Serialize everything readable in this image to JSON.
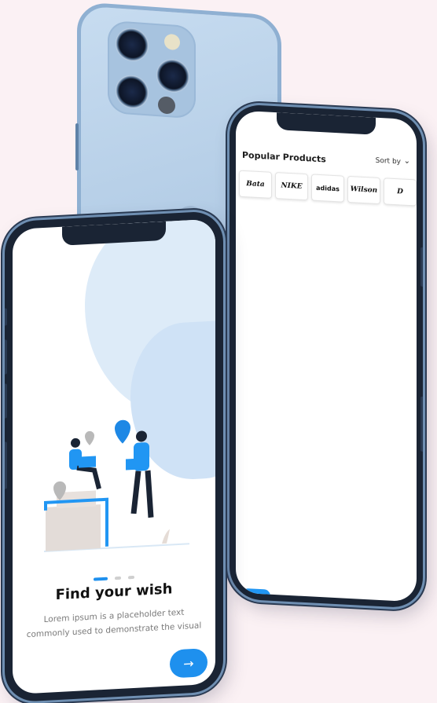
{
  "back_phone": {
    "apple_logo_icon": "apple-logo-icon"
  },
  "products_screen": {
    "title": "Popular Products",
    "sort_label": "Sort by",
    "sort_icon": "chevron-down-icon",
    "brands": [
      "Bata",
      "NIKE",
      "adidas",
      "Wilson",
      "D"
    ]
  },
  "onboarding_screen": {
    "title": "Find your wish",
    "body": "Lorem ipsum is a placeholder text commonly used  to demonstrate the visual",
    "pager": {
      "active_index": 0,
      "count": 3
    },
    "next_icon": "arrow-right-icon"
  },
  "colors": {
    "accent": "#1e90ee",
    "back_phone": "#b4cde6",
    "background": "#fbf1f4"
  }
}
